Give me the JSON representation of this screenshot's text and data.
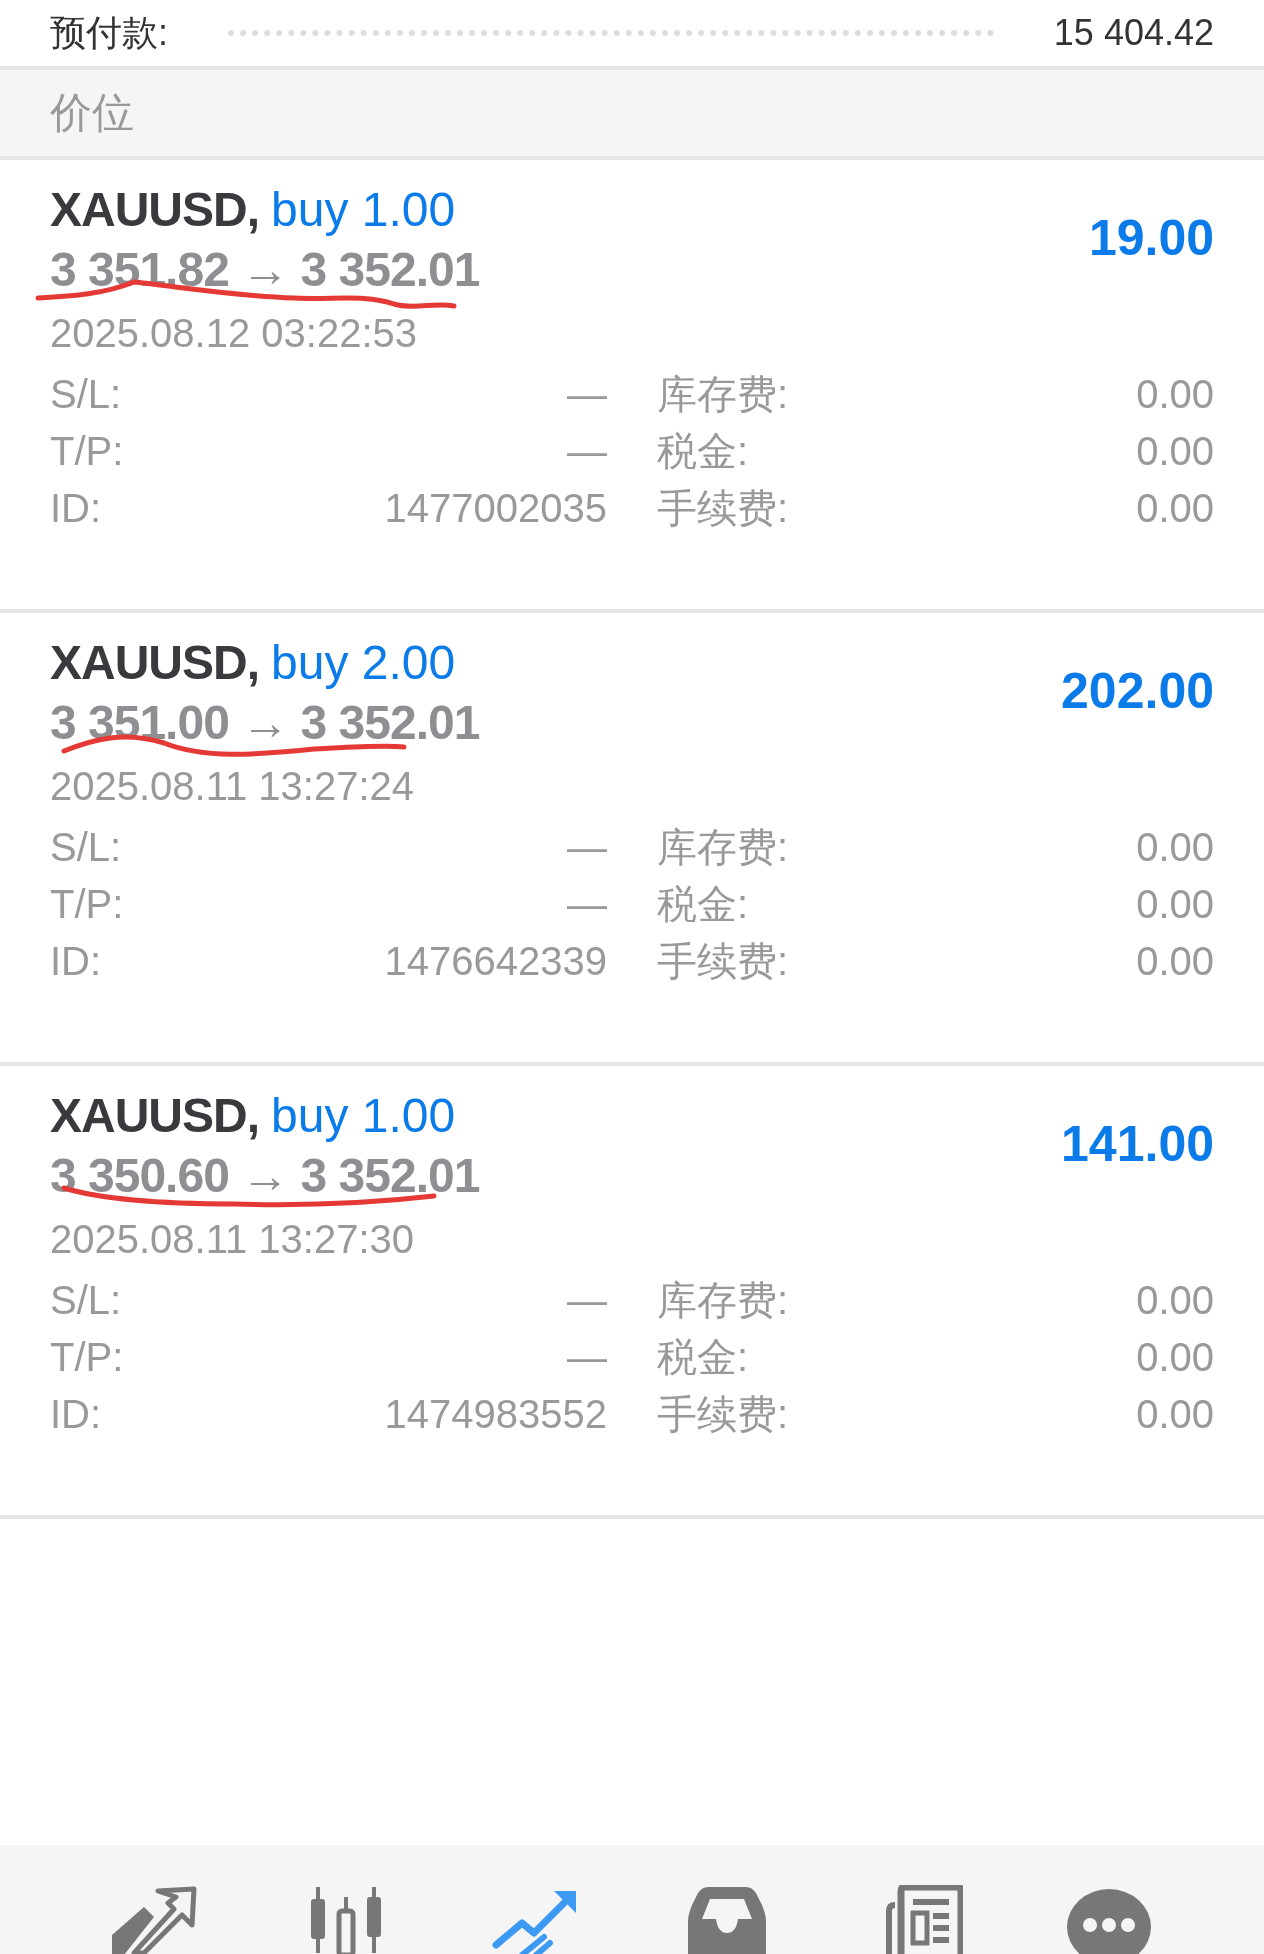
{
  "summary": {
    "label": "预付款:",
    "value": "15 404.42"
  },
  "section": {
    "title": "价位"
  },
  "orders": [
    {
      "symbol": "XAUUSD,",
      "side": "buy 1.00",
      "prices": "3 351.82 → 3 352.01",
      "profit": "19.00",
      "time": "2025.08.12 03:22:53",
      "underlined": true,
      "details": [
        [
          "S/L:",
          "—",
          "库存费:",
          "0.00"
        ],
        [
          "T/P:",
          "—",
          "税金:",
          "0.00"
        ],
        [
          "ID:",
          "1477002035",
          "手续费:",
          "0.00"
        ]
      ]
    },
    {
      "symbol": "XAUUSD,",
      "side": "buy 2.00",
      "prices": "3 351.00 → 3 352.01",
      "profit": "202.00",
      "time": "2025.08.11 13:27:24",
      "underlined": true,
      "details": [
        [
          "S/L:",
          "—",
          "库存费:",
          "0.00"
        ],
        [
          "T/P:",
          "—",
          "税金:",
          "0.00"
        ],
        [
          "ID:",
          "1476642339",
          "手续费:",
          "0.00"
        ]
      ]
    },
    {
      "symbol": "XAUUSD,",
      "side": "buy 1.00",
      "prices": "3 350.60 → 3 352.01",
      "profit": "141.00",
      "time": "2025.08.11 13:27:30",
      "underlined": true,
      "details": [
        [
          "S/L:",
          "—",
          "库存费:",
          "0.00"
        ],
        [
          "T/P:",
          "—",
          "税金:",
          "0.00"
        ],
        [
          "ID:",
          "1474983552",
          "手续费:",
          "0.00"
        ]
      ]
    }
  ],
  "nav": [
    {
      "kind": "trade",
      "selected": false
    },
    {
      "kind": "chart",
      "selected": false
    },
    {
      "kind": "history",
      "selected": true
    },
    {
      "kind": "inbox",
      "selected": false
    },
    {
      "kind": "news",
      "selected": false
    },
    {
      "kind": "more",
      "selected": false
    }
  ]
}
